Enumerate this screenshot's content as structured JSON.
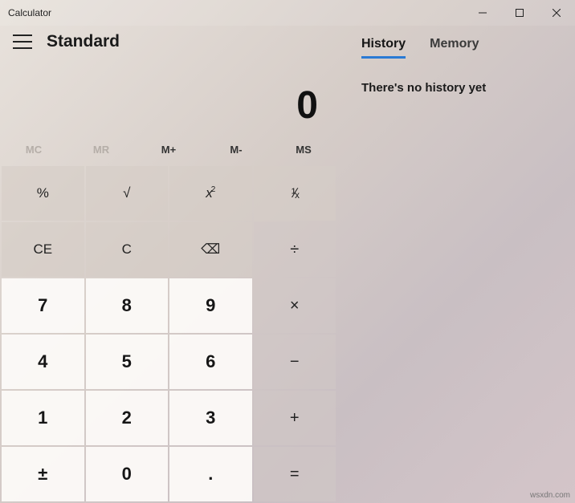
{
  "window": {
    "title": "Calculator"
  },
  "header": {
    "mode": "Standard"
  },
  "display": {
    "value": "0"
  },
  "memory": {
    "mc": "MC",
    "mr": "MR",
    "mplus": "M+",
    "mminus": "M-",
    "ms": "MS"
  },
  "keys": {
    "percent": "%",
    "sqrt": "√",
    "square_x": "x",
    "square_exp": "2",
    "reciprocal": "¹∕ₓ",
    "ce": "CE",
    "c": "C",
    "backspace": "⌫",
    "divide": "÷",
    "n7": "7",
    "n8": "8",
    "n9": "9",
    "multiply": "×",
    "n4": "4",
    "n5": "5",
    "n6": "6",
    "minus": "−",
    "n1": "1",
    "n2": "2",
    "n3": "3",
    "plus": "+",
    "negate": "±",
    "n0": "0",
    "decimal": ".",
    "equals": "="
  },
  "side": {
    "tab_history": "History",
    "tab_memory": "Memory",
    "history_empty": "There's no history yet"
  },
  "watermark": "wsxdn.com"
}
